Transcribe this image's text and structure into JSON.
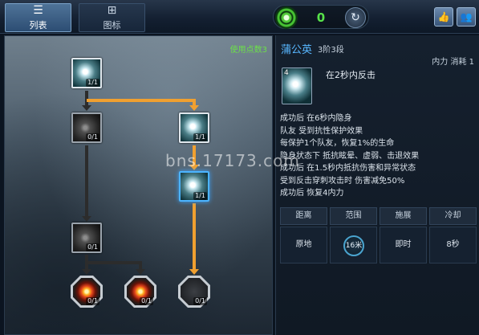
{
  "tabs": [
    {
      "label": "列表",
      "icon": "list-icon",
      "glyph": "☰",
      "active": true
    },
    {
      "label": "图标",
      "icon": "grid-icon",
      "glyph": "⊞",
      "active": false
    }
  ],
  "points": {
    "value": "0",
    "icon": "green-swirl-icon",
    "reset_icon": "reset-icon",
    "reset_glyph": "↻"
  },
  "corner_buttons": [
    {
      "icon": "thumbs-up-icon",
      "glyph": "👍"
    },
    {
      "icon": "group-icon",
      "glyph": "👥"
    }
  ],
  "tree": {
    "points_used": "使用点数3",
    "nodes": [
      {
        "id": "top",
        "count": "1/1",
        "state": "learned"
      },
      {
        "id": "l1",
        "count": "0/1",
        "state": "locked"
      },
      {
        "id": "r1",
        "count": "1/1",
        "state": "learned"
      },
      {
        "id": "r2",
        "count": "1/1",
        "state": "selected"
      },
      {
        "id": "l2",
        "count": "0/1",
        "state": "locked"
      },
      {
        "id": "b1",
        "count": "0/1",
        "state": "fire"
      },
      {
        "id": "b2",
        "count": "0/1",
        "state": "fire"
      },
      {
        "id": "b3",
        "count": "0/1",
        "state": "locked"
      }
    ],
    "colors": {
      "active_path": "#f0a030",
      "inactive_path": "#2c2c2c"
    }
  },
  "skill": {
    "name": "蒲公英",
    "rank": "3阶3段",
    "cost": "内力 消耗 1",
    "icon_key": "4",
    "summary": "在2秒内反击",
    "effects": [
      "成功后 在6秒内隐身",
      "队友 受到抗性保护效果",
      "每保护1个队友，恢复1%的生命",
      "隐身状态下 抵抗眩晕、虚弱、击退效果",
      "成功后 在1.5秒内抵抗伤害和异常状态",
      "受到反击穿刺攻击时 伤害减免50%",
      "成功后 恢复4内力"
    ],
    "stats": [
      {
        "label": "距离",
        "value": "原地"
      },
      {
        "label": "范围",
        "value": "16米"
      },
      {
        "label": "施展",
        "value": "即时"
      },
      {
        "label": "冷却",
        "value": "8秒"
      }
    ]
  },
  "watermark": "bns.17173.com"
}
